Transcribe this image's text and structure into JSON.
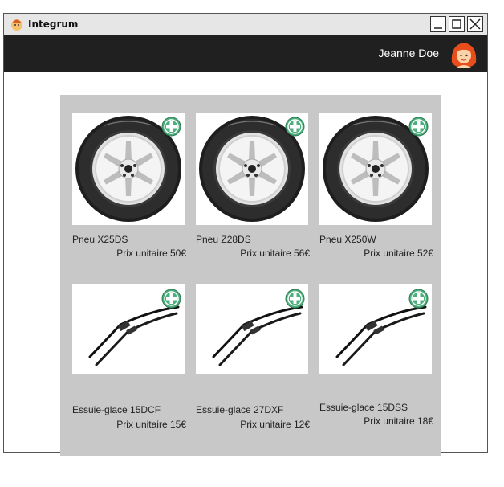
{
  "window": {
    "title": "Integrum",
    "controls": [
      "minimize-icon",
      "maximize-icon",
      "close-icon"
    ]
  },
  "header": {
    "user_name": "Jeanne Doe",
    "avatar": "user-avatar"
  },
  "products": [
    {
      "name": "Pneu X25DS",
      "price": "Prix unitaire 50€",
      "kind": "tire"
    },
    {
      "name": "Pneu Z28DS",
      "price": "Prix unitaire 56€",
      "kind": "tire"
    },
    {
      "name": "Pneu X250W",
      "price": "Prix unitaire 52€",
      "kind": "tire"
    },
    {
      "name": "Essuie-glace 15DCF",
      "price": "Prix unitaire 15€",
      "kind": "wiper"
    },
    {
      "name": "Essuie-glace 27DXF",
      "price": "Prix unitaire 12€",
      "kind": "wiper"
    },
    {
      "name": "Essuie-glace 15DSS",
      "price": "Prix unitaire 18€",
      "kind": "wiper"
    }
  ],
  "colors": {
    "header_bg": "#202020",
    "catalog_bg": "#c8c8c8",
    "add_button": "#4caf7d"
  }
}
